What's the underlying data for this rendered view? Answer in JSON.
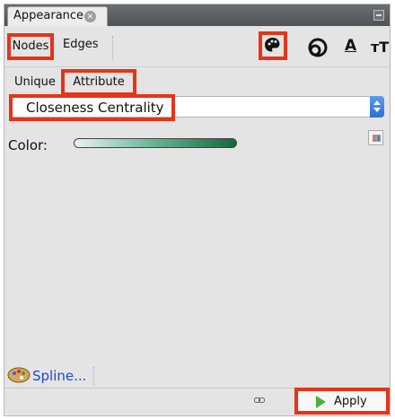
{
  "panel": {
    "tab_title": "Appearance"
  },
  "element_tabs": {
    "nodes_label": "Nodes",
    "edges_label": "Edges"
  },
  "toolbar_icons": [
    "palette-icon",
    "size-icon",
    "label-color-icon",
    "label-size-icon"
  ],
  "label_color_glyph": "A",
  "label_size_glyph": "тT",
  "mode_tabs": {
    "unique_label": "Unique",
    "attribute_label": "Attribute"
  },
  "attribute_select": {
    "value": "Closeness Centrality"
  },
  "color": {
    "label": "Color:",
    "gradient_colors": [
      "#e9f3ee",
      "#66b292",
      "#14683d"
    ]
  },
  "spline": {
    "label": "Spline..."
  },
  "footer": {
    "apply_label": "Apply"
  },
  "highlight_color": "#e53418"
}
